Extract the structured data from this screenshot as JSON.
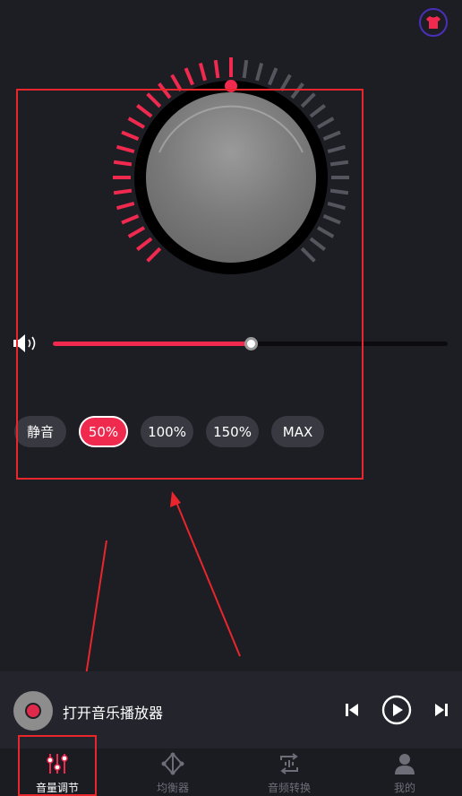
{
  "volume": {
    "percent": 0.5,
    "dial_active_fraction": 0.5
  },
  "presets": [
    {
      "label": "静音",
      "active": false
    },
    {
      "label": "50%",
      "active": true
    },
    {
      "label": "100%",
      "active": false
    },
    {
      "label": "150%",
      "active": false
    },
    {
      "label": "MAX",
      "active": false
    }
  ],
  "player": {
    "title": "打开音乐播放器"
  },
  "tabs": [
    {
      "label": "音量调节",
      "icon": "equalizer-sliders-icon",
      "active": true
    },
    {
      "label": "均衡器",
      "icon": "network-nodes-icon",
      "active": false
    },
    {
      "label": "音频转换",
      "icon": "audio-convert-icon",
      "active": false
    },
    {
      "label": "我的",
      "icon": "user-icon",
      "active": false
    }
  ],
  "colors": {
    "accent": "#f0294f",
    "background": "#1d1d24",
    "annotation": "#e8262c"
  },
  "icons": {
    "top_right": "tshirt-skin-icon",
    "volume": "speaker-icon"
  }
}
